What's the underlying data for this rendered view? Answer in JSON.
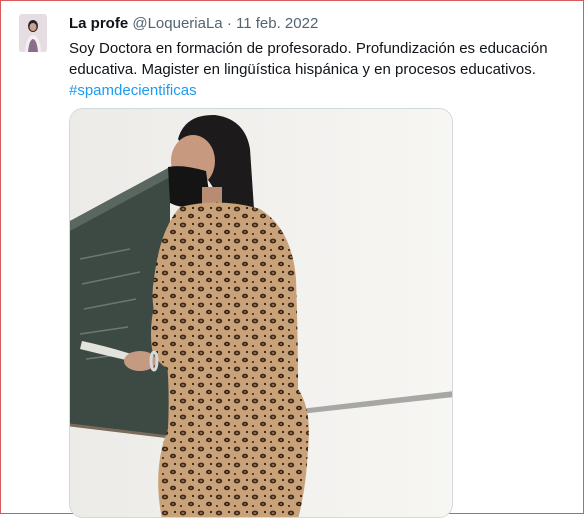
{
  "tweet": {
    "author_name": "La profe",
    "handle": "@LoqueriaLa",
    "separator": "·",
    "date": "11 feb. 2022",
    "text_line1": "Soy Doctora en formación de profesorado. Profundización es educación",
    "text_line2": "educativa. Magister en lingüística hispánica y en procesos educativos.",
    "hashtag": "#spamdecientificas"
  },
  "colors": {
    "hashtag": "#1d9bf0",
    "muted": "#536471",
    "text": "#0f1419",
    "frame": "#d85a5a"
  }
}
